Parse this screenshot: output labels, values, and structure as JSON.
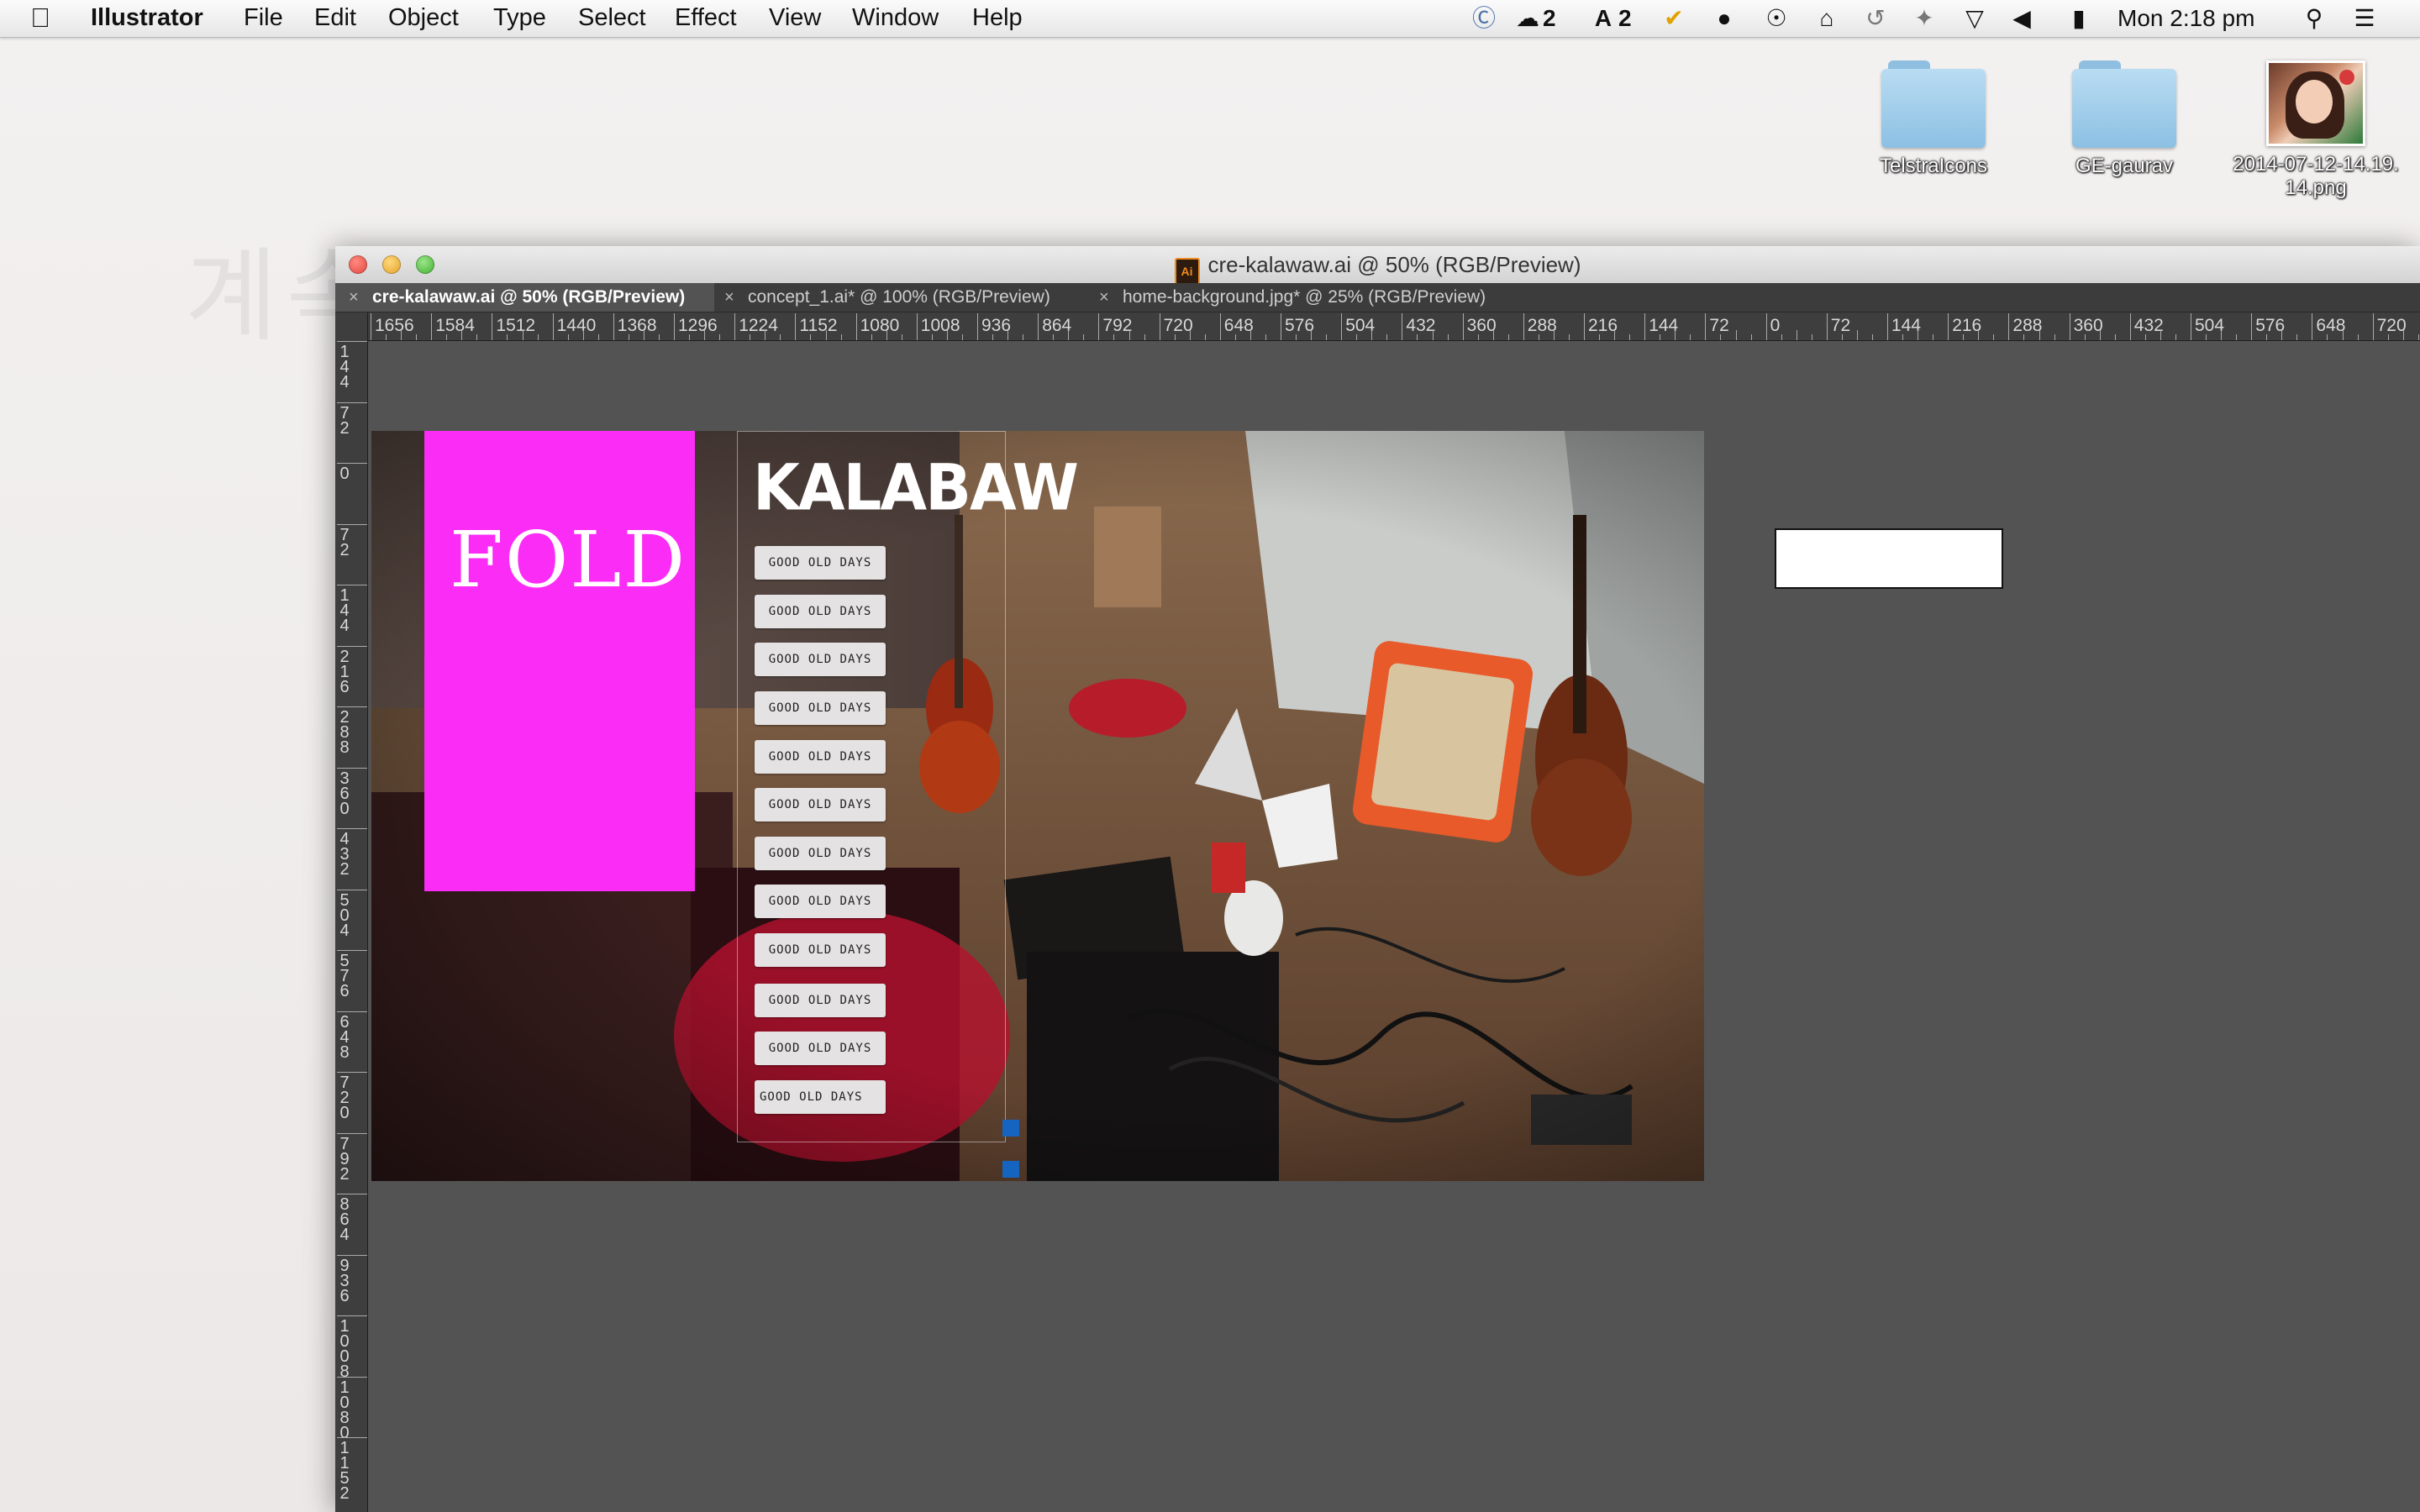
{
  "menubar": {
    "app_name": "Illustrator",
    "items": [
      "File",
      "Edit",
      "Object",
      "Type",
      "Select",
      "Effect",
      "View",
      "Window",
      "Help"
    ],
    "tray": {
      "badge_1": "2",
      "badge_2": "2",
      "clock": "Mon 2:18 pm"
    }
  },
  "desktop": {
    "ghost_text": "계속할",
    "icons": [
      {
        "label": "TelstraIcons",
        "kind": "folder"
      },
      {
        "label": "GE-gaurav",
        "kind": "folder"
      },
      {
        "label": "2014-07-12-14.19.14.png",
        "kind": "image"
      }
    ]
  },
  "window": {
    "title": "cre-kalawaw.ai @ 50% (RGB/Preview)",
    "app_badge": "Ai",
    "tabs": [
      {
        "label": "cre-kalawaw.ai @ 50% (RGB/Preview)",
        "active": true
      },
      {
        "label": "concept_1.ai* @ 100% (RGB/Preview)",
        "active": false
      },
      {
        "label": "home-background.jpg* @ 25% (RGB/Preview)",
        "active": false
      }
    ],
    "tab_close": "×"
  },
  "rulers": {
    "horizontal": [
      "1656",
      "1584",
      "1512",
      "1440",
      "1368",
      "1296",
      "1224",
      "1152",
      "1080",
      "1008",
      "936",
      "864",
      "792",
      "720",
      "648",
      "576",
      "504",
      "432",
      "360",
      "288",
      "216",
      "144",
      "72",
      "0",
      "72",
      "144",
      "216",
      "288",
      "360",
      "432",
      "504",
      "576",
      "648",
      "720"
    ],
    "vertical": [
      "144",
      "72",
      "0",
      "72",
      "144",
      "216",
      "288",
      "360",
      "432",
      "504",
      "576",
      "648",
      "720",
      "792",
      "864",
      "936",
      "1008",
      "1080",
      "1152"
    ]
  },
  "artboard": {
    "fold_label": "FOLD",
    "brand": "KALABAW",
    "nav_buttons": [
      "GOOD OLD DAYS",
      "GOOD OLD DAYS",
      "GOOD OLD DAYS",
      "GOOD OLD DAYS",
      "GOOD OLD DAYS",
      "GOOD OLD DAYS",
      "GOOD OLD DAYS",
      "GOOD OLD DAYS",
      "GOOD OLD DAYS",
      "GOOD OLD DAYS",
      "GOOD OLD DAYS",
      "GOOD OLD DAYS"
    ]
  },
  "colors": {
    "fold_pink": "#fb2cf5",
    "canvas_gray": "#535353",
    "selection_blue": "#1565c0"
  }
}
